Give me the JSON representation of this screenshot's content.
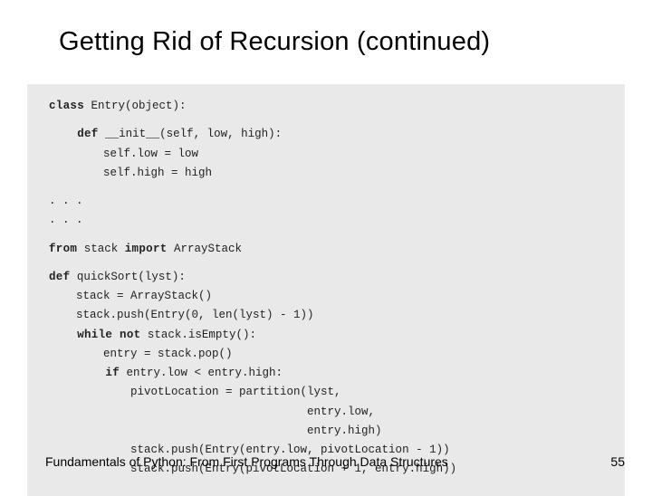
{
  "title": "Getting Rid of Recursion (continued)",
  "code": {
    "l01a": "class",
    "l01b": " Entry(object):",
    "l02a": "    def",
    "l02b": " __init__(self, low, high):",
    "l03": "        self.low = low",
    "l04": "        self.high = high",
    "l05": ". . .",
    "l06": ". . .",
    "l07a": "from",
    "l07b": " stack ",
    "l07c": "import",
    "l07d": " ArrayStack",
    "l08a": "def",
    "l08b": " quickSort(lyst):",
    "l09": "    stack = ArrayStack()",
    "l10": "    stack.push(Entry(0, len(lyst) - 1))",
    "l11a": "    while not",
    "l11b": " stack.isEmpty():",
    "l12": "        entry = stack.pop()",
    "l13a": "        if",
    "l13b": " entry.low < entry.high:",
    "l14": "            pivotLocation = partition(lyst,",
    "l15": "                                      entry.low,",
    "l16": "                                      entry.high)",
    "l17": "            stack.push(Entry(entry.low, pivotLocation - 1))",
    "l18": "            stack.push(Entry(pivotLocation + 1, entry.high))"
  },
  "footer": {
    "book": "Fundamentals of Python: From First Programs Through Data Structures",
    "page": "55"
  }
}
